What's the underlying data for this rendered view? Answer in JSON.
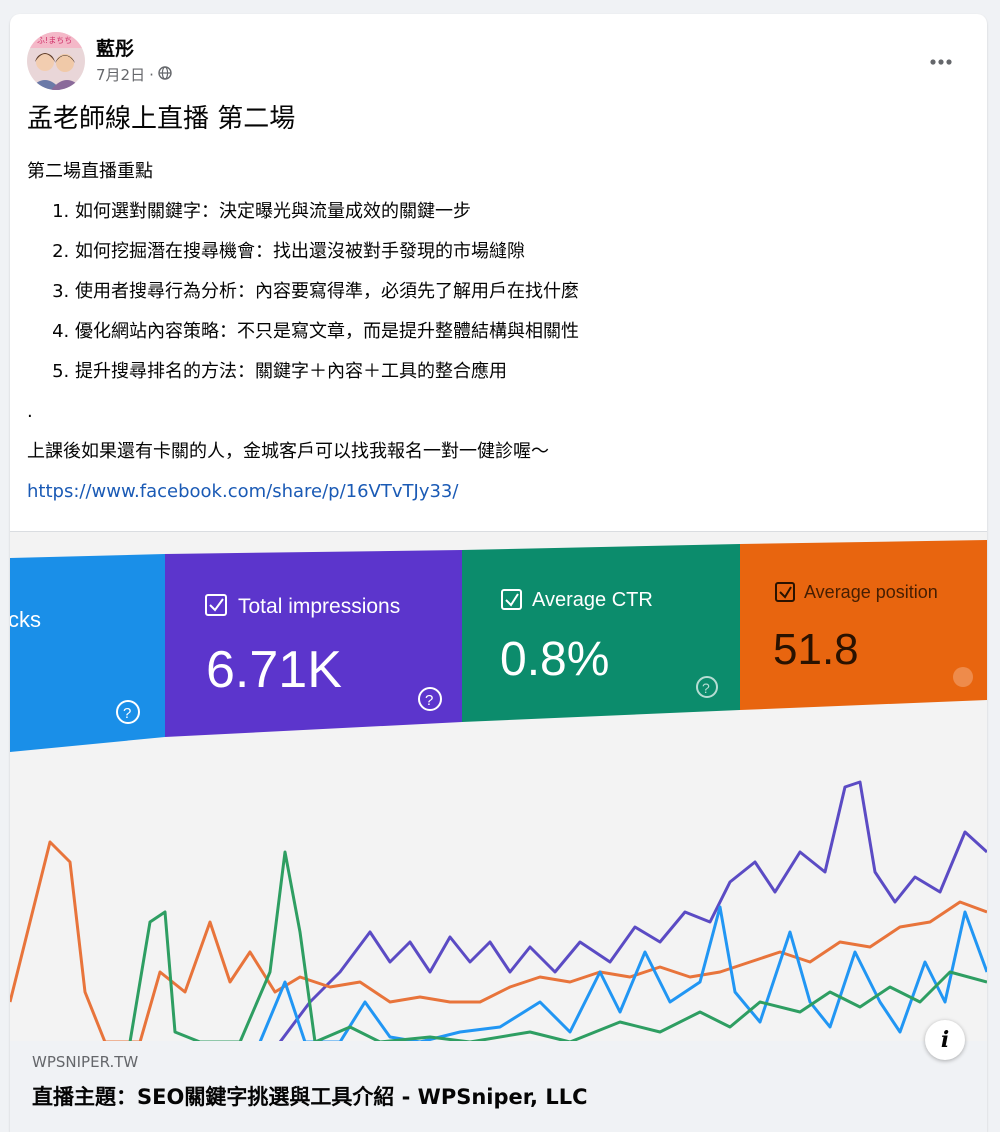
{
  "post": {
    "author": "藍彤",
    "date": "7月2日",
    "separator": "·",
    "privacy_icon": "globe-icon",
    "more_icon": "more-options-icon",
    "title": "孟老師線上直播 第二場",
    "subtitle": "第二場直播重點",
    "points": [
      "如何選對關鍵字：決定曝光與流量成效的關鍵一步",
      "如何挖掘潛在搜尋機會：找出還沒被對手發現的市場縫隙",
      "使用者搜尋行為分析：內容要寫得準，必須先了解用戶在找什麼",
      "優化網站內容策略：不只是寫文章，而是提升整體結構與相關性",
      "提升搜尋排名的方法：關鍵字＋內容＋工具的整合應用"
    ],
    "dot": ".",
    "closing": "上課後如果還有卡關的人，金城客戶可以找我報名一對一健診喔～",
    "url": "https://www.facebook.com/share/p/16VTvTJy33/"
  },
  "preview": {
    "tiles": [
      {
        "label": "cks",
        "value": "",
        "color": "#1a8fe8"
      },
      {
        "label": "Total impressions",
        "value": "6.71K",
        "color": "#5c35cc"
      },
      {
        "label": "Average CTR",
        "value": "0.8%",
        "color": "#0c8c6c"
      },
      {
        "label": "Average position",
        "value": "51.8",
        "color": "#e8650f"
      }
    ],
    "help_glyph": "?",
    "series_colors": [
      "#5b4bc4",
      "#e8743b",
      "#2196f3",
      "#2e9e62"
    ],
    "domain": "WPSNIPER.TW",
    "title": "直播主題：SEO關鍵字挑選與工具介紹 - WPSniper, LLC",
    "info_glyph": "i"
  }
}
